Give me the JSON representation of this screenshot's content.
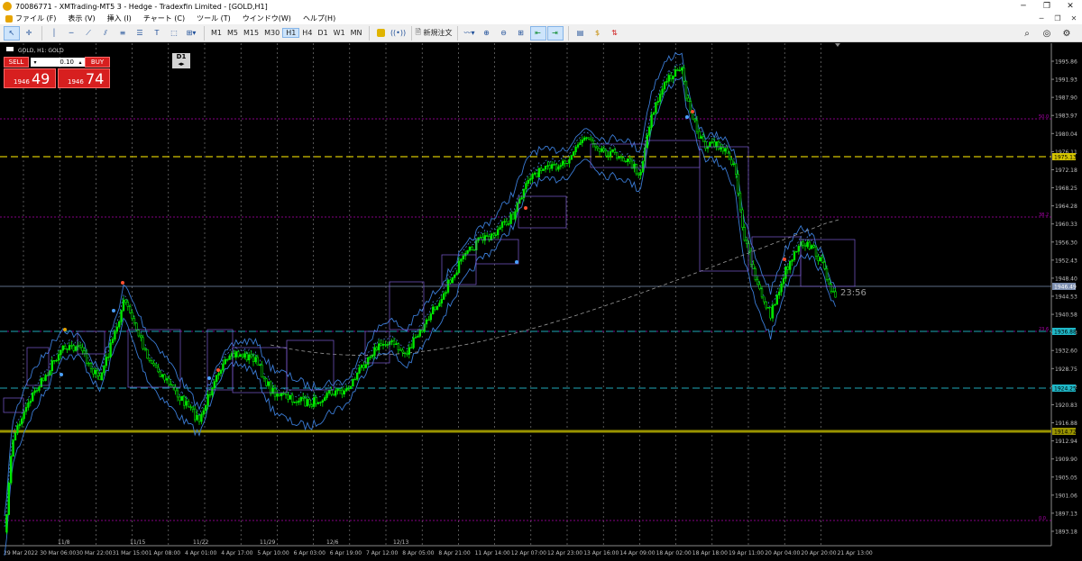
{
  "window": {
    "title": "70086771 - XMTrading-MT5 3 - Hedge - Tradexfin Limited - [GOLD,H1]",
    "minimize": "─",
    "maximize": "❐",
    "close": "✕"
  },
  "menu": [
    "ファイル (F)",
    "表示 (V)",
    "挿入 (I)",
    "チャート (C)",
    "ツール (T)",
    "ウインドウ(W)",
    "ヘルプ(H)"
  ],
  "toolbar": {
    "timeframes": [
      "M1",
      "M5",
      "M15",
      "M30",
      "H1",
      "H4",
      "D1",
      "W1",
      "MN"
    ],
    "active_timeframe": "H1",
    "new_order_label": "新規注文"
  },
  "chart": {
    "symbol_label": "GOLD, H1:  GOLD",
    "countdown": "23:56",
    "d1_label": "D1",
    "colors": {
      "candle": "#00e600",
      "band": "#3a7bd5",
      "grid": "#ffffff",
      "axis_text": "#c0c0c0"
    },
    "price_axis": [
      "1995.86",
      "1991.93",
      "1987.90",
      "1983.97",
      "1980.04",
      "1976.11",
      "1972.18",
      "1968.25",
      "1964.28",
      "1960.33",
      "1956.30",
      "1952.43",
      "1948.40",
      "1944.53",
      "1940.58",
      "1936.63",
      "1932.60",
      "1928.75",
      "1924.72",
      "1920.83",
      "1916.88",
      "1912.94",
      "1909.90",
      "1905.05",
      "1901.06",
      "1897.13",
      "1893.18"
    ],
    "time_axis": [
      "29 Mar 2022",
      "30 Mar 06:00",
      "30 Mar 22:00",
      "31 Mar 15:00",
      "1 Apr 08:00",
      "4 Apr 01:00",
      "4 Apr 17:00",
      "5 Apr 10:00",
      "6 Apr 03:00",
      "6 Apr 19:00",
      "7 Apr 12:00",
      "8 Apr 05:00",
      "8 Apr 21:00",
      "11 Apr 14:00",
      "12 Apr 07:00",
      "12 Apr 23:00",
      "13 Apr 16:00",
      "14 Apr 09:00",
      "18 Apr 02:00",
      "18 Apr 18:00",
      "19 Apr 11:00",
      "20 Apr 04:00",
      "20 Apr 20:00",
      "21 Apr 13:00"
    ],
    "date_marks": [
      "11/8",
      "11/15",
      "11/22",
      "11/29",
      "12/6",
      "12/13"
    ],
    "levels": [
      {
        "label": "1975.13",
        "kind": "yellow-dashed"
      },
      {
        "label": "1946.49",
        "kind": "bid-line"
      },
      {
        "label": "1936.88",
        "kind": "cyan-dashed"
      },
      {
        "label": "1924.25",
        "kind": "cyan-dashed"
      },
      {
        "label": "1914.72",
        "kind": "olive-solid"
      }
    ],
    "fibo_labels": [
      "50.0",
      "38.2",
      "23.6",
      "0.0"
    ]
  },
  "trade": {
    "sell_label": "SELL",
    "buy_label": "BUY",
    "lot": "0.10",
    "bid_small": "1946",
    "bid_big": "49",
    "ask_small": "1946",
    "ask_big": "74"
  }
}
